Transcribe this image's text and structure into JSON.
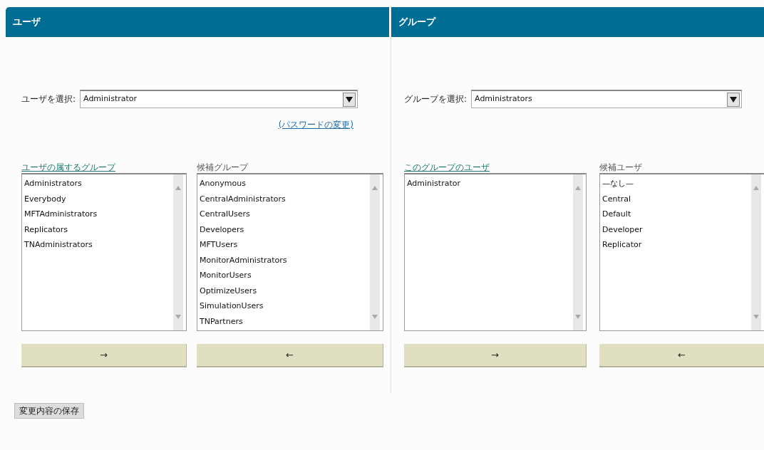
{
  "panels": [
    {
      "title": "ユーザ",
      "select": {
        "label": "ユーザを選択:",
        "value": "Administrator"
      },
      "link": "(パスワードの変更)",
      "lists": [
        {
          "label": "ユーザの属するグループ",
          "items": [
            "Administrators",
            "Everybody",
            "MFTAdministrators",
            "Replicators",
            "TNAdministrators"
          ],
          "button": "→"
        },
        {
          "label": "候補グループ",
          "items": [
            "Anonymous",
            "CentralAdministrators",
            "CentralUsers",
            "Developers",
            "MFTUsers",
            "MonitorAdministrators",
            "MonitorUsers",
            "OptimizeUsers",
            "SimulationUsers",
            "TNPartners"
          ],
          "button": "←"
        }
      ]
    },
    {
      "title": "グループ",
      "select": {
        "label": "グループを選択:",
        "value": "Administrators"
      },
      "lists": [
        {
          "label": "このグループのユーザ",
          "items": [
            "Administrator"
          ],
          "button": "→"
        },
        {
          "label": "候補ユーザ",
          "items": [
            "—なし—",
            "Central",
            "Default",
            "Developer",
            "Replicator"
          ],
          "button": "←"
        }
      ]
    }
  ],
  "save_button": "変更内容の保存"
}
